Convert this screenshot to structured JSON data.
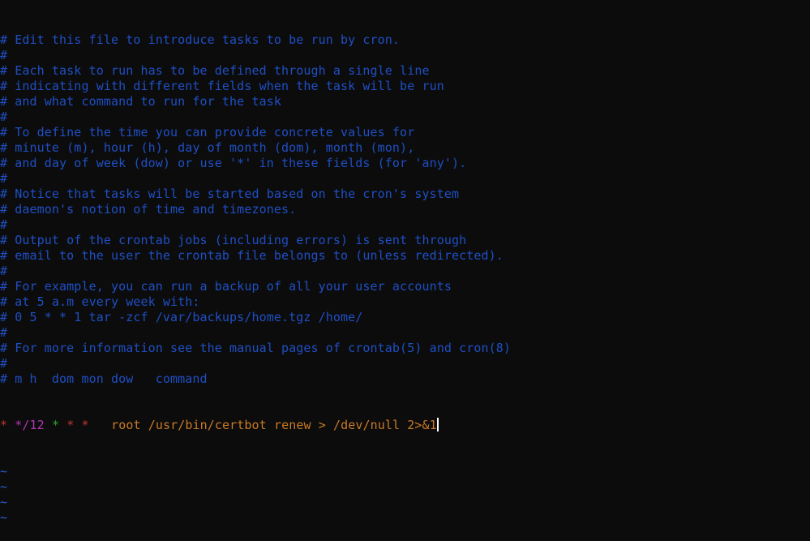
{
  "colors": {
    "background": "#0c0c0c",
    "comment": "#1f4fc4",
    "minute_field": "#b535b5",
    "hour_field": "#2fa12f",
    "star_field": "#c23535",
    "command": "#c97a27",
    "tilde": "#2b5fd0",
    "cursor": "#ffffff"
  },
  "editor": {
    "comment_lines": [
      "# Edit this file to introduce tasks to be run by cron.",
      "#",
      "# Each task to run has to be defined through a single line",
      "# indicating with different fields when the task will be run",
      "# and what command to run for the task",
      "#",
      "# To define the time you can provide concrete values for",
      "# minute (m), hour (h), day of month (dom), month (mon),",
      "# and day of week (dow) or use '*' in these fields (for 'any').",
      "#",
      "# Notice that tasks will be started based on the cron's system",
      "# daemon's notion of time and timezones.",
      "#",
      "# Output of the crontab jobs (including errors) is sent through",
      "# email to the user the crontab file belongs to (unless redirected).",
      "#",
      "# For example, you can run a backup of all your user accounts",
      "# at 5 a.m every week with:",
      "# 0 5 * * 1 tar -zcf /var/backups/home.tgz /home/",
      "#",
      "# For more information see the manual pages of crontab(5) and cron(8)",
      "#",
      "# m h  dom mon dow   command"
    ],
    "cron_entry": {
      "minute": "*",
      "hour": "*/12",
      "dom": "*",
      "mon": "*",
      "dow": "*",
      "command": "root /usr/bin/certbot renew > /dev/null 2>&1"
    },
    "tilde": "~",
    "tilde_count": 4
  }
}
